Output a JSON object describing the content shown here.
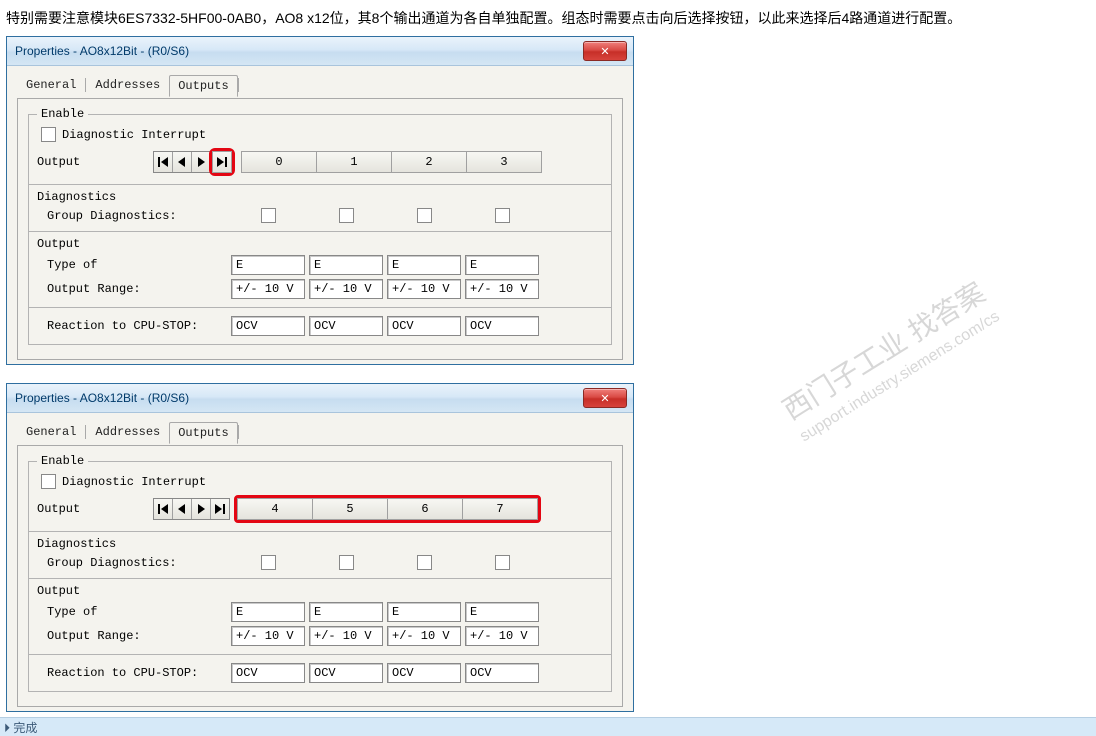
{
  "intro": "特别需要注意模块6ES7332-5HF00-0AB0，AO8 x12位，其8个输出通道为各自单独配置。组态时需要点击向后选择按钮，以此来选择后4路通道进行配置。",
  "dialog_title": "Properties - AO8x12Bit - (R0/S6)",
  "close_glyph": "✕",
  "tabs": {
    "general": "General",
    "addresses": "Addresses",
    "outputs": "Outputs"
  },
  "enable": {
    "legend": "Enable",
    "diag_interrupt": "Diagnostic Interrupt"
  },
  "output_label": "Output",
  "channels_a": [
    "0",
    "1",
    "2",
    "3"
  ],
  "channels_b": [
    "4",
    "5",
    "6",
    "7"
  ],
  "diag": {
    "heading": "Diagnostics",
    "group": "Group Diagnostics:"
  },
  "outgrp": {
    "heading": "Output",
    "type_of": "Type of",
    "output_range": "Output Range:",
    "reaction": "Reaction to CPU-STOP:"
  },
  "values": {
    "type_of": [
      "E",
      "E",
      "E",
      "E"
    ],
    "output_range": [
      "+/- 10 V",
      "+/- 10 V",
      "+/- 10 V",
      "+/- 10 V"
    ],
    "reaction": [
      "OCV",
      "OCV",
      "OCV",
      "OCV"
    ]
  },
  "bottom": "⏵ 完成",
  "wm": {
    "a": "西门子工业   找答案",
    "b": "support.industry.siemens.com/cs"
  }
}
